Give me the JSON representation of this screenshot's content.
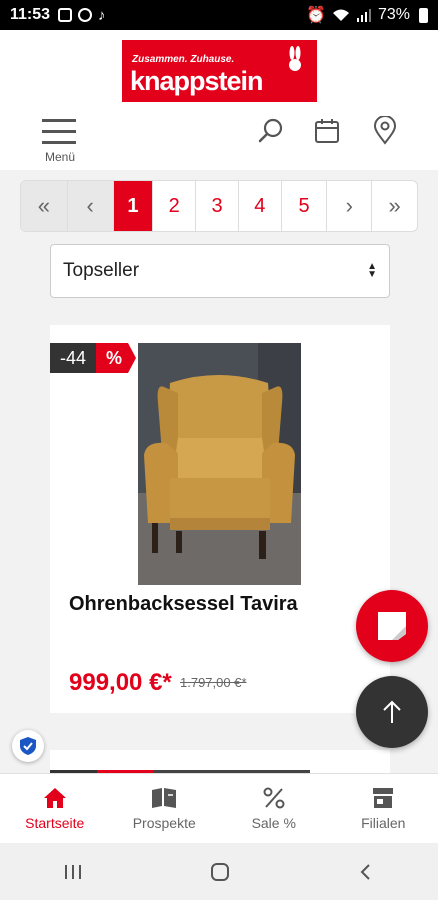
{
  "status_bar": {
    "time": "11:53",
    "battery": "73%"
  },
  "header": {
    "logo_tagline": "Zusammen. Zuhause.",
    "logo_brand": "knappstein",
    "menu_label": "Menü"
  },
  "pagination": {
    "first": "«",
    "prev": "‹",
    "pages": [
      "1",
      "2",
      "3",
      "4",
      "5"
    ],
    "next": "›",
    "last": "»",
    "current": "1"
  },
  "sort": {
    "selected": "Topseller"
  },
  "product": {
    "discount": "-44",
    "sale_badge": "%",
    "name": "Ohrenbacksessel Tavira",
    "price": "999,00 €*",
    "old_price": "1.797,00 €*"
  },
  "bottom_nav": {
    "items": [
      {
        "label": "Startseite",
        "icon": "home-icon"
      },
      {
        "label": "Prospekte",
        "icon": "brochure-icon"
      },
      {
        "label": "Sale %",
        "icon": "percent-icon"
      },
      {
        "label": "Filialen",
        "icon": "store-icon"
      }
    ],
    "active": "Startseite"
  },
  "colors": {
    "brand_red": "#e2001a",
    "dark": "#333333"
  }
}
